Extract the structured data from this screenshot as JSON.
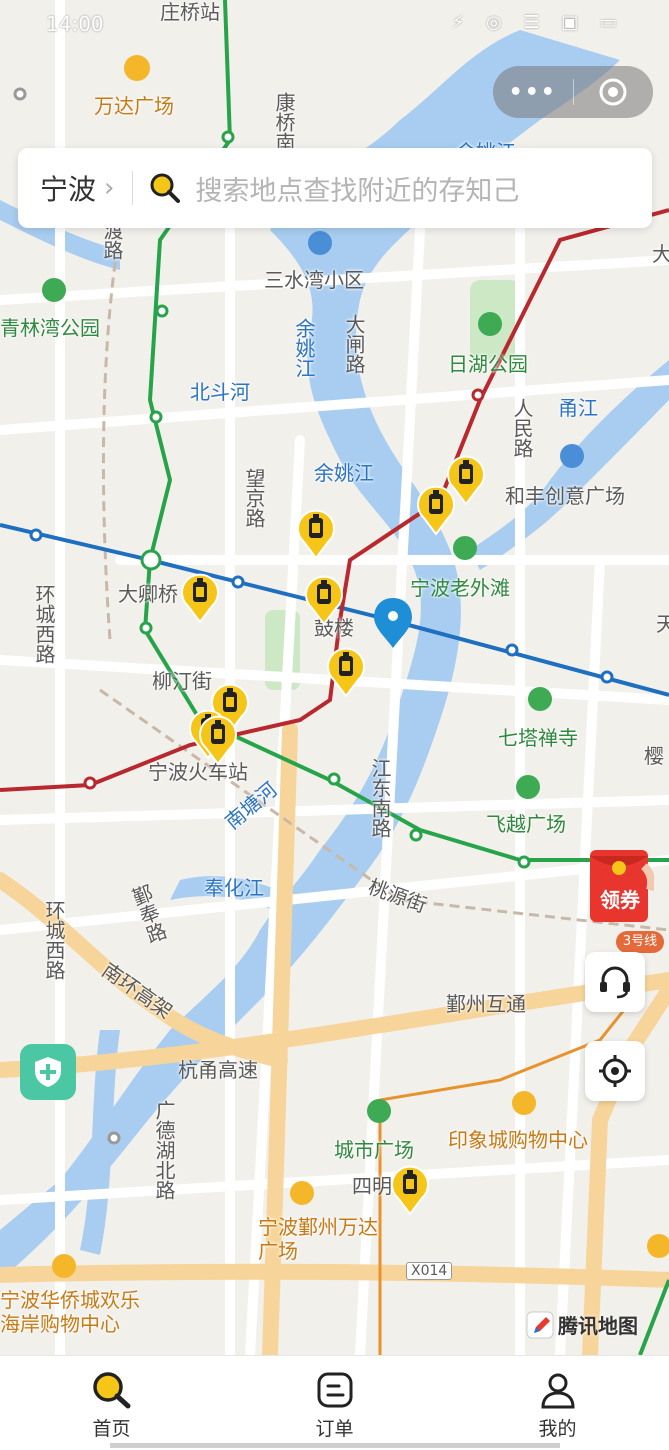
{
  "status_bar": {
    "time": "14:00",
    "icons": "⚡ ◎ ☰ ▣ ▭"
  },
  "capsule": {
    "more_label": "•••"
  },
  "search": {
    "city": "宁波",
    "placeholder": "搜索地点查找附近的存知己"
  },
  "map_labels": {
    "zhuangqiao_station": "庄桥站",
    "wanda_plaza": "万达广场",
    "kangqiao_road": "康桥南路",
    "yuyao_river_top": "余姚江",
    "qingyuan_road": "林渡路",
    "sanshuiwan": "三水湾小区",
    "qinglinwan_park": "青林湾公园",
    "yuyao_river_mid": "余姚江",
    "dazha_road": "大闸路",
    "rihu_park": "日湖公园",
    "beidou_river": "北斗河",
    "renmin_road": "人民路",
    "yongjiang": "甬江",
    "yuyao_river_low": "余姚江",
    "hefeng_plaza": "和丰创意广场",
    "wangjing_road": "望京路",
    "daqing_bridge": "大卿桥",
    "old_bund": "宁波老外滩",
    "huancheng_west_n": "环城西路",
    "gulou": "鼓楼",
    "liuting_street": "柳汀街",
    "qita_temple": "七塔禅寺",
    "ningbo_station": "宁波火车站",
    "jiangdong_south": "江东南路",
    "feiyue_plaza": "飞越广场",
    "nantang_river": "南塘河",
    "fenghua_river": "奉化江",
    "taoyuan_street": "桃源街",
    "yinfeng_road": "鄞奉路",
    "nanhuan_elevated": "南环高架",
    "huancheng_west_s": "环城西路",
    "yinzhou_interchange": "鄞州互通",
    "hangyong_highway": "杭甬高速",
    "guangde_lake": "广德湖北路",
    "city_plaza": "城市广场",
    "impression_mall": "印象城购物中心",
    "siming_road": "四明路",
    "yinzhou_wanda": "宁波鄞州万达广场",
    "x014": "X014",
    "overseas_town": "宁波华侨城欢乐海岸购物中心",
    "edge_da": "大",
    "edge_tian": "天",
    "edge_ying": "樱"
  },
  "map_brand": "腾讯地图",
  "coupon": {
    "label": "领券",
    "metro": "3号线"
  },
  "tabs": [
    {
      "label": "首页",
      "icon": "search-icon",
      "active": true
    },
    {
      "label": "订单",
      "icon": "order-icon",
      "active": false
    },
    {
      "label": "我的",
      "icon": "profile-icon",
      "active": false
    }
  ],
  "colors": {
    "accent": "#f5c518",
    "metro_blue": "#1f6fc0",
    "metro_green": "#27a44a",
    "metro_red": "#b8282e",
    "water": "#a8cdf0",
    "road": "#ffffff",
    "highway": "#f7d59a"
  }
}
